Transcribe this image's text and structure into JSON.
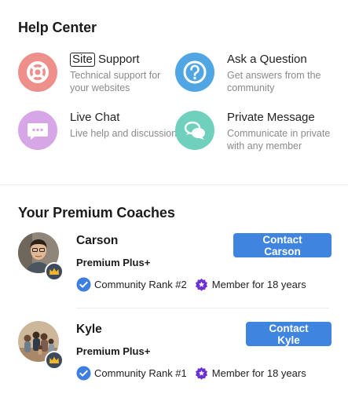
{
  "help_center": {
    "title": "Help Center",
    "items": [
      {
        "id": "site",
        "title_boxed": "Site",
        "title_rest": " Support",
        "desc": "Technical support for your websites",
        "icon": "lifebuoy-icon",
        "color": "#ef8f8c"
      },
      {
        "id": "ask",
        "title": "Ask a Question",
        "desc": "Get answers from the community",
        "icon": "question-icon",
        "color": "#4fa6e3"
      },
      {
        "id": "chat",
        "title": "Live Chat",
        "desc": "Live help and discussion",
        "icon": "chat-icon",
        "color": "#d7a6e6"
      },
      {
        "id": "pm",
        "title": "Private Message",
        "desc": "Communicate in private with any member",
        "icon": "speech-bubbles-icon",
        "color": "#6fd1bd"
      }
    ]
  },
  "coaches": {
    "title": "Your Premium Coaches",
    "items": [
      {
        "name": "Carson",
        "tier": "Premium Plus+",
        "rank": "Community Rank #2",
        "member": "Member for 18 years",
        "button": "Contact Carson"
      },
      {
        "name": "Kyle",
        "tier": "Premium Plus+",
        "rank": "Community Rank #1",
        "member": "Member for 18 years",
        "button": "Contact Kyle"
      }
    ]
  },
  "colors": {
    "accent": "#3f85e0",
    "badge_blue": "#3d7ee0",
    "badge_purple": "#6b2fd6",
    "crown_gold": "#f2b628"
  }
}
